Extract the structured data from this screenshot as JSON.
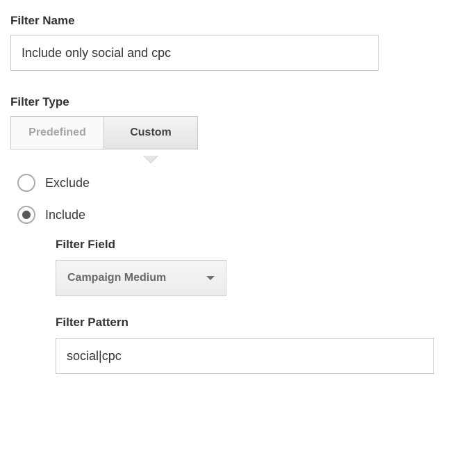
{
  "filterName": {
    "label": "Filter Name",
    "value": "Include only social and cpc"
  },
  "filterType": {
    "label": "Filter Type",
    "tabs": {
      "predefined": "Predefined",
      "custom": "Custom"
    },
    "selected": "custom"
  },
  "radios": {
    "exclude": "Exclude",
    "include": "Include",
    "selected": "include"
  },
  "filterField": {
    "label": "Filter Field",
    "selected": "Campaign Medium"
  },
  "filterPattern": {
    "label": "Filter Pattern",
    "value": "social|cpc"
  }
}
